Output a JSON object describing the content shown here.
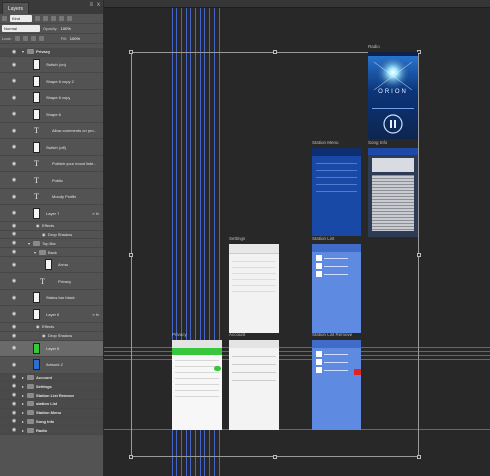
{
  "panel": {
    "tab_label": "Layers",
    "close_glyph": "x",
    "menu_glyph": "≡",
    "filter_kind": "Kind",
    "blend_mode": "Normal",
    "opacity_label": "Opacity:",
    "opacity_value": "100%",
    "lock_label": "Lock:",
    "fill_label": "Fill:",
    "fill_value": "100%",
    "layers": [
      {
        "id": "privacy-group",
        "label": "Privacy",
        "kind": "group",
        "indent": 0,
        "height": "short"
      },
      {
        "id": "switch-on",
        "label": "Switch (on)",
        "kind": "smart",
        "indent": 1,
        "height": "tall"
      },
      {
        "id": "shape6-copy2",
        "label": "Shape 6 copy 2",
        "kind": "shape",
        "indent": 1,
        "height": "tall"
      },
      {
        "id": "shape6-copy",
        "label": "Shape 6 copy",
        "kind": "shape",
        "indent": 1,
        "height": "tall"
      },
      {
        "id": "shape6",
        "label": "Shape 6",
        "kind": "shape",
        "indent": 1,
        "height": "tall"
      },
      {
        "id": "allow-comments",
        "label": "Allow comments on pro...",
        "kind": "text",
        "indent": 1,
        "height": "tall"
      },
      {
        "id": "switch-off",
        "label": "Switch (off)",
        "kind": "smart",
        "indent": 1,
        "height": "tall"
      },
      {
        "id": "publish-mood",
        "label": "Publish your mood liste...",
        "kind": "text",
        "indent": 1,
        "height": "tall"
      },
      {
        "id": "public",
        "label": "Public",
        "kind": "text",
        "indent": 1,
        "height": "tall"
      },
      {
        "id": "moody-profile",
        "label": "Moody Profile",
        "kind": "text",
        "indent": 1,
        "height": "tall"
      },
      {
        "id": "layer7",
        "label": "Layer 7",
        "kind": "layer",
        "indent": 1,
        "height": "tall",
        "fx": true
      },
      {
        "id": "effects-1",
        "label": "Effects",
        "kind": "effects",
        "indent": 2,
        "height": "short"
      },
      {
        "id": "dropshadow-1",
        "label": "Drop Shadow",
        "kind": "effect",
        "indent": 3,
        "height": "short"
      },
      {
        "id": "top-bar",
        "label": "Top Bar",
        "kind": "group",
        "indent": 1,
        "height": "short"
      },
      {
        "id": "back",
        "label": "Back",
        "kind": "group",
        "indent": 2,
        "height": "short"
      },
      {
        "id": "arrow",
        "label": "Arrow",
        "kind": "smart",
        "indent": 3,
        "height": "tall"
      },
      {
        "id": "privacy-text",
        "label": "Privacy",
        "kind": "text",
        "indent": 2,
        "height": "tall"
      },
      {
        "id": "status-bar",
        "label": "Status bar black",
        "kind": "smart",
        "indent": 1,
        "height": "tall"
      },
      {
        "id": "layer6",
        "label": "Layer 6",
        "kind": "layer",
        "indent": 1,
        "height": "tall",
        "fx": true
      },
      {
        "id": "effects-2",
        "label": "Effects",
        "kind": "effects",
        "indent": 2,
        "height": "short"
      },
      {
        "id": "dropshadow-2",
        "label": "Drop Shadow",
        "kind": "effect",
        "indent": 3,
        "height": "short"
      },
      {
        "id": "layer8",
        "label": "Layer 8",
        "kind": "green",
        "indent": 1,
        "height": "tall",
        "selected": true
      },
      {
        "id": "artwork2",
        "label": "Artwork 2",
        "kind": "blue",
        "indent": 1,
        "height": "tall"
      },
      {
        "id": "account",
        "label": "Account",
        "kind": "group",
        "indent": 0,
        "height": "short"
      },
      {
        "id": "settings",
        "label": "Settings",
        "kind": "group",
        "indent": 0,
        "height": "short"
      },
      {
        "id": "station-list-remove",
        "label": "Station List Remove",
        "kind": "group",
        "indent": 0,
        "height": "short"
      },
      {
        "id": "station-list",
        "label": "station List",
        "kind": "group",
        "indent": 0,
        "height": "short"
      },
      {
        "id": "station-menu",
        "label": "Station Menu",
        "kind": "group",
        "indent": 0,
        "height": "short"
      },
      {
        "id": "song-info",
        "label": "Song Info",
        "kind": "group",
        "indent": 0,
        "height": "short"
      },
      {
        "id": "radio",
        "label": "Radio",
        "kind": "group",
        "indent": 0,
        "height": "short"
      }
    ]
  },
  "canvas": {
    "artboards": [
      {
        "id": "radio",
        "label": "Radio",
        "brand_text": "ORION"
      },
      {
        "id": "station-menu",
        "label": "Station Menu"
      },
      {
        "id": "song-info",
        "label": "Song Info"
      },
      {
        "id": "settings",
        "label": "Settings"
      },
      {
        "id": "station-list",
        "label": "Station List"
      },
      {
        "id": "privacy",
        "label": "Privacy"
      },
      {
        "id": "account",
        "label": "Account"
      },
      {
        "id": "station-list-remove",
        "label": "Station List Remove"
      }
    ]
  },
  "colors": {
    "guide": "#4f79ff",
    "selected_layer": "#6a6a6a",
    "switch_on": "#38c73c",
    "remove_button": "#e02424"
  }
}
